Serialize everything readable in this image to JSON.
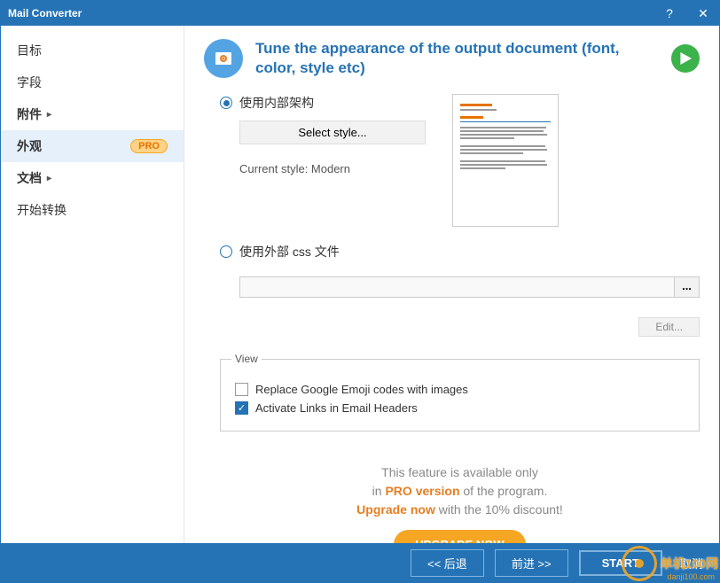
{
  "titlebar": {
    "title": "Mail Converter"
  },
  "sidebar": {
    "items": [
      {
        "label": "目标",
        "has_arrow": false,
        "bold": false
      },
      {
        "label": "字段",
        "has_arrow": false,
        "bold": false
      },
      {
        "label": "附件",
        "has_arrow": true,
        "bold": true
      },
      {
        "label": "外观",
        "has_arrow": false,
        "bold": true,
        "badge": "PRO"
      },
      {
        "label": "文档",
        "has_arrow": true,
        "bold": true
      },
      {
        "label": "开始转换",
        "has_arrow": false,
        "bold": false
      }
    ]
  },
  "header": {
    "text": "Tune the appearance of the output document (font, color, style etc)"
  },
  "style_section": {
    "radio_internal": "使用内部架构",
    "select_style_btn": "Select style...",
    "current_style_label": "Current style: Modern",
    "radio_external": "使用外部 css 文件",
    "css_path": "",
    "browse_label": "...",
    "edit_btn": "Edit..."
  },
  "view_section": {
    "legend": "View",
    "replace_emoji": "Replace Google Emoji codes with images",
    "activate_links": "Activate Links in Email Headers"
  },
  "promo": {
    "line1_a": "This feature is available only",
    "line2_a": "in ",
    "line2_b": "PRO version",
    "line2_c": " of the program.",
    "line3_a": "Upgrade now",
    "line3_b": " with the 10% discount!",
    "button": "UPGRADE NOW"
  },
  "footer": {
    "back": "<< 后退",
    "forward": "前进 >>",
    "start": "START",
    "cancel": "取消"
  },
  "watermark": {
    "brand": "单机100网",
    "url": "danji100.com"
  }
}
